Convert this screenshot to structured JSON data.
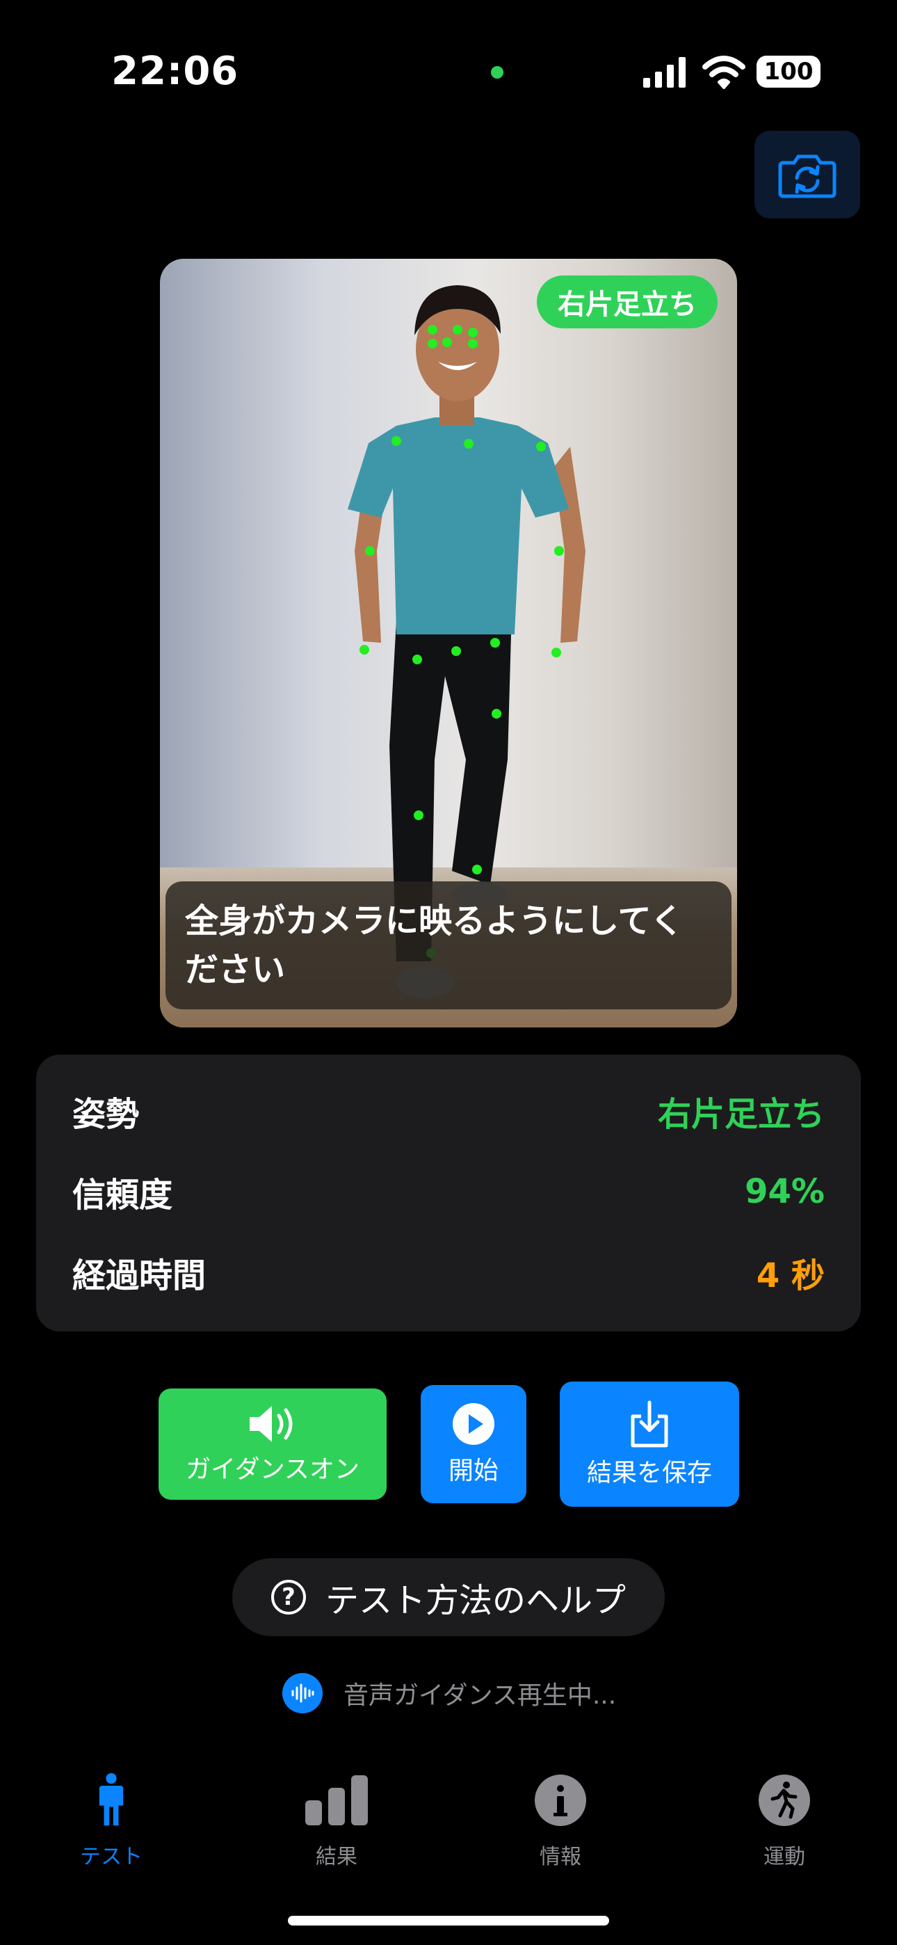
{
  "status_bar": {
    "time": "22:06",
    "battery": "100"
  },
  "preview": {
    "pose_badge": "右片足立ち",
    "hint": "全身がカメラに映るようにしてください"
  },
  "stats": {
    "rows": [
      {
        "label": "姿勢",
        "value": "右片足立ち",
        "color": "#30d158"
      },
      {
        "label": "信頼度",
        "value": "94%",
        "color": "#30d158"
      },
      {
        "label": "経過時間",
        "value": "4 秒",
        "color": "#ff9f0a"
      }
    ]
  },
  "controls": {
    "guidance": "ガイダンスオン",
    "start": "開始",
    "save": "結果を保存"
  },
  "help_button": "テスト方法のヘルプ",
  "audio_status": "音声ガイダンス再生中...",
  "tabs": [
    {
      "label": "テスト",
      "icon": "person-icon",
      "active": true
    },
    {
      "label": "結果",
      "icon": "chart-bars-icon",
      "active": false
    },
    {
      "label": "情報",
      "icon": "info-icon",
      "active": false
    },
    {
      "label": "運動",
      "icon": "walk-icon",
      "active": false
    }
  ],
  "colors": {
    "accent": "#0a84ff",
    "success": "#30d158",
    "warning": "#ff9f0a"
  }
}
